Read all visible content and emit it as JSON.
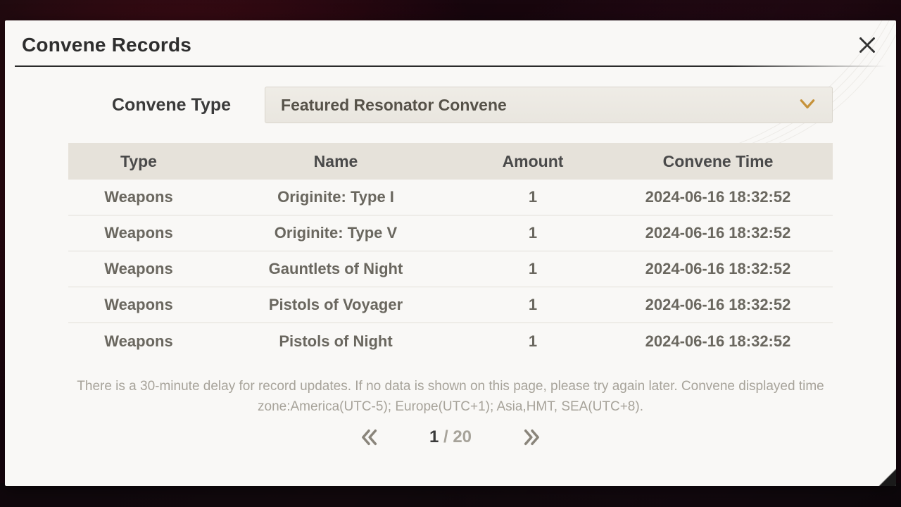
{
  "header": {
    "title": "Convene Records"
  },
  "filter": {
    "label": "Convene Type",
    "selected": "Featured Resonator Convene"
  },
  "table": {
    "columns": [
      "Type",
      "Name",
      "Amount",
      "Convene Time"
    ],
    "rows": [
      {
        "type": "Weapons",
        "name": "Originite: Type I",
        "amount": "1",
        "time": "2024-06-16 18:32:52"
      },
      {
        "type": "Weapons",
        "name": "Originite: Type V",
        "amount": "1",
        "time": "2024-06-16 18:32:52"
      },
      {
        "type": "Weapons",
        "name": "Gauntlets of Night",
        "amount": "1",
        "time": "2024-06-16 18:32:52"
      },
      {
        "type": "Weapons",
        "name": "Pistols of Voyager",
        "amount": "1",
        "time": "2024-06-16 18:32:52"
      },
      {
        "type": "Weapons",
        "name": "Pistols of Night",
        "amount": "1",
        "time": "2024-06-16 18:32:52"
      }
    ]
  },
  "footer_note": "There is a 30-minute delay for record updates. If no data is shown on this page, please try again later. Convene displayed time zone:America(UTC-5); Europe(UTC+1); Asia,HMT, SEA(UTC+8).",
  "pagination": {
    "current": "1",
    "separator": " / ",
    "total": "20"
  }
}
